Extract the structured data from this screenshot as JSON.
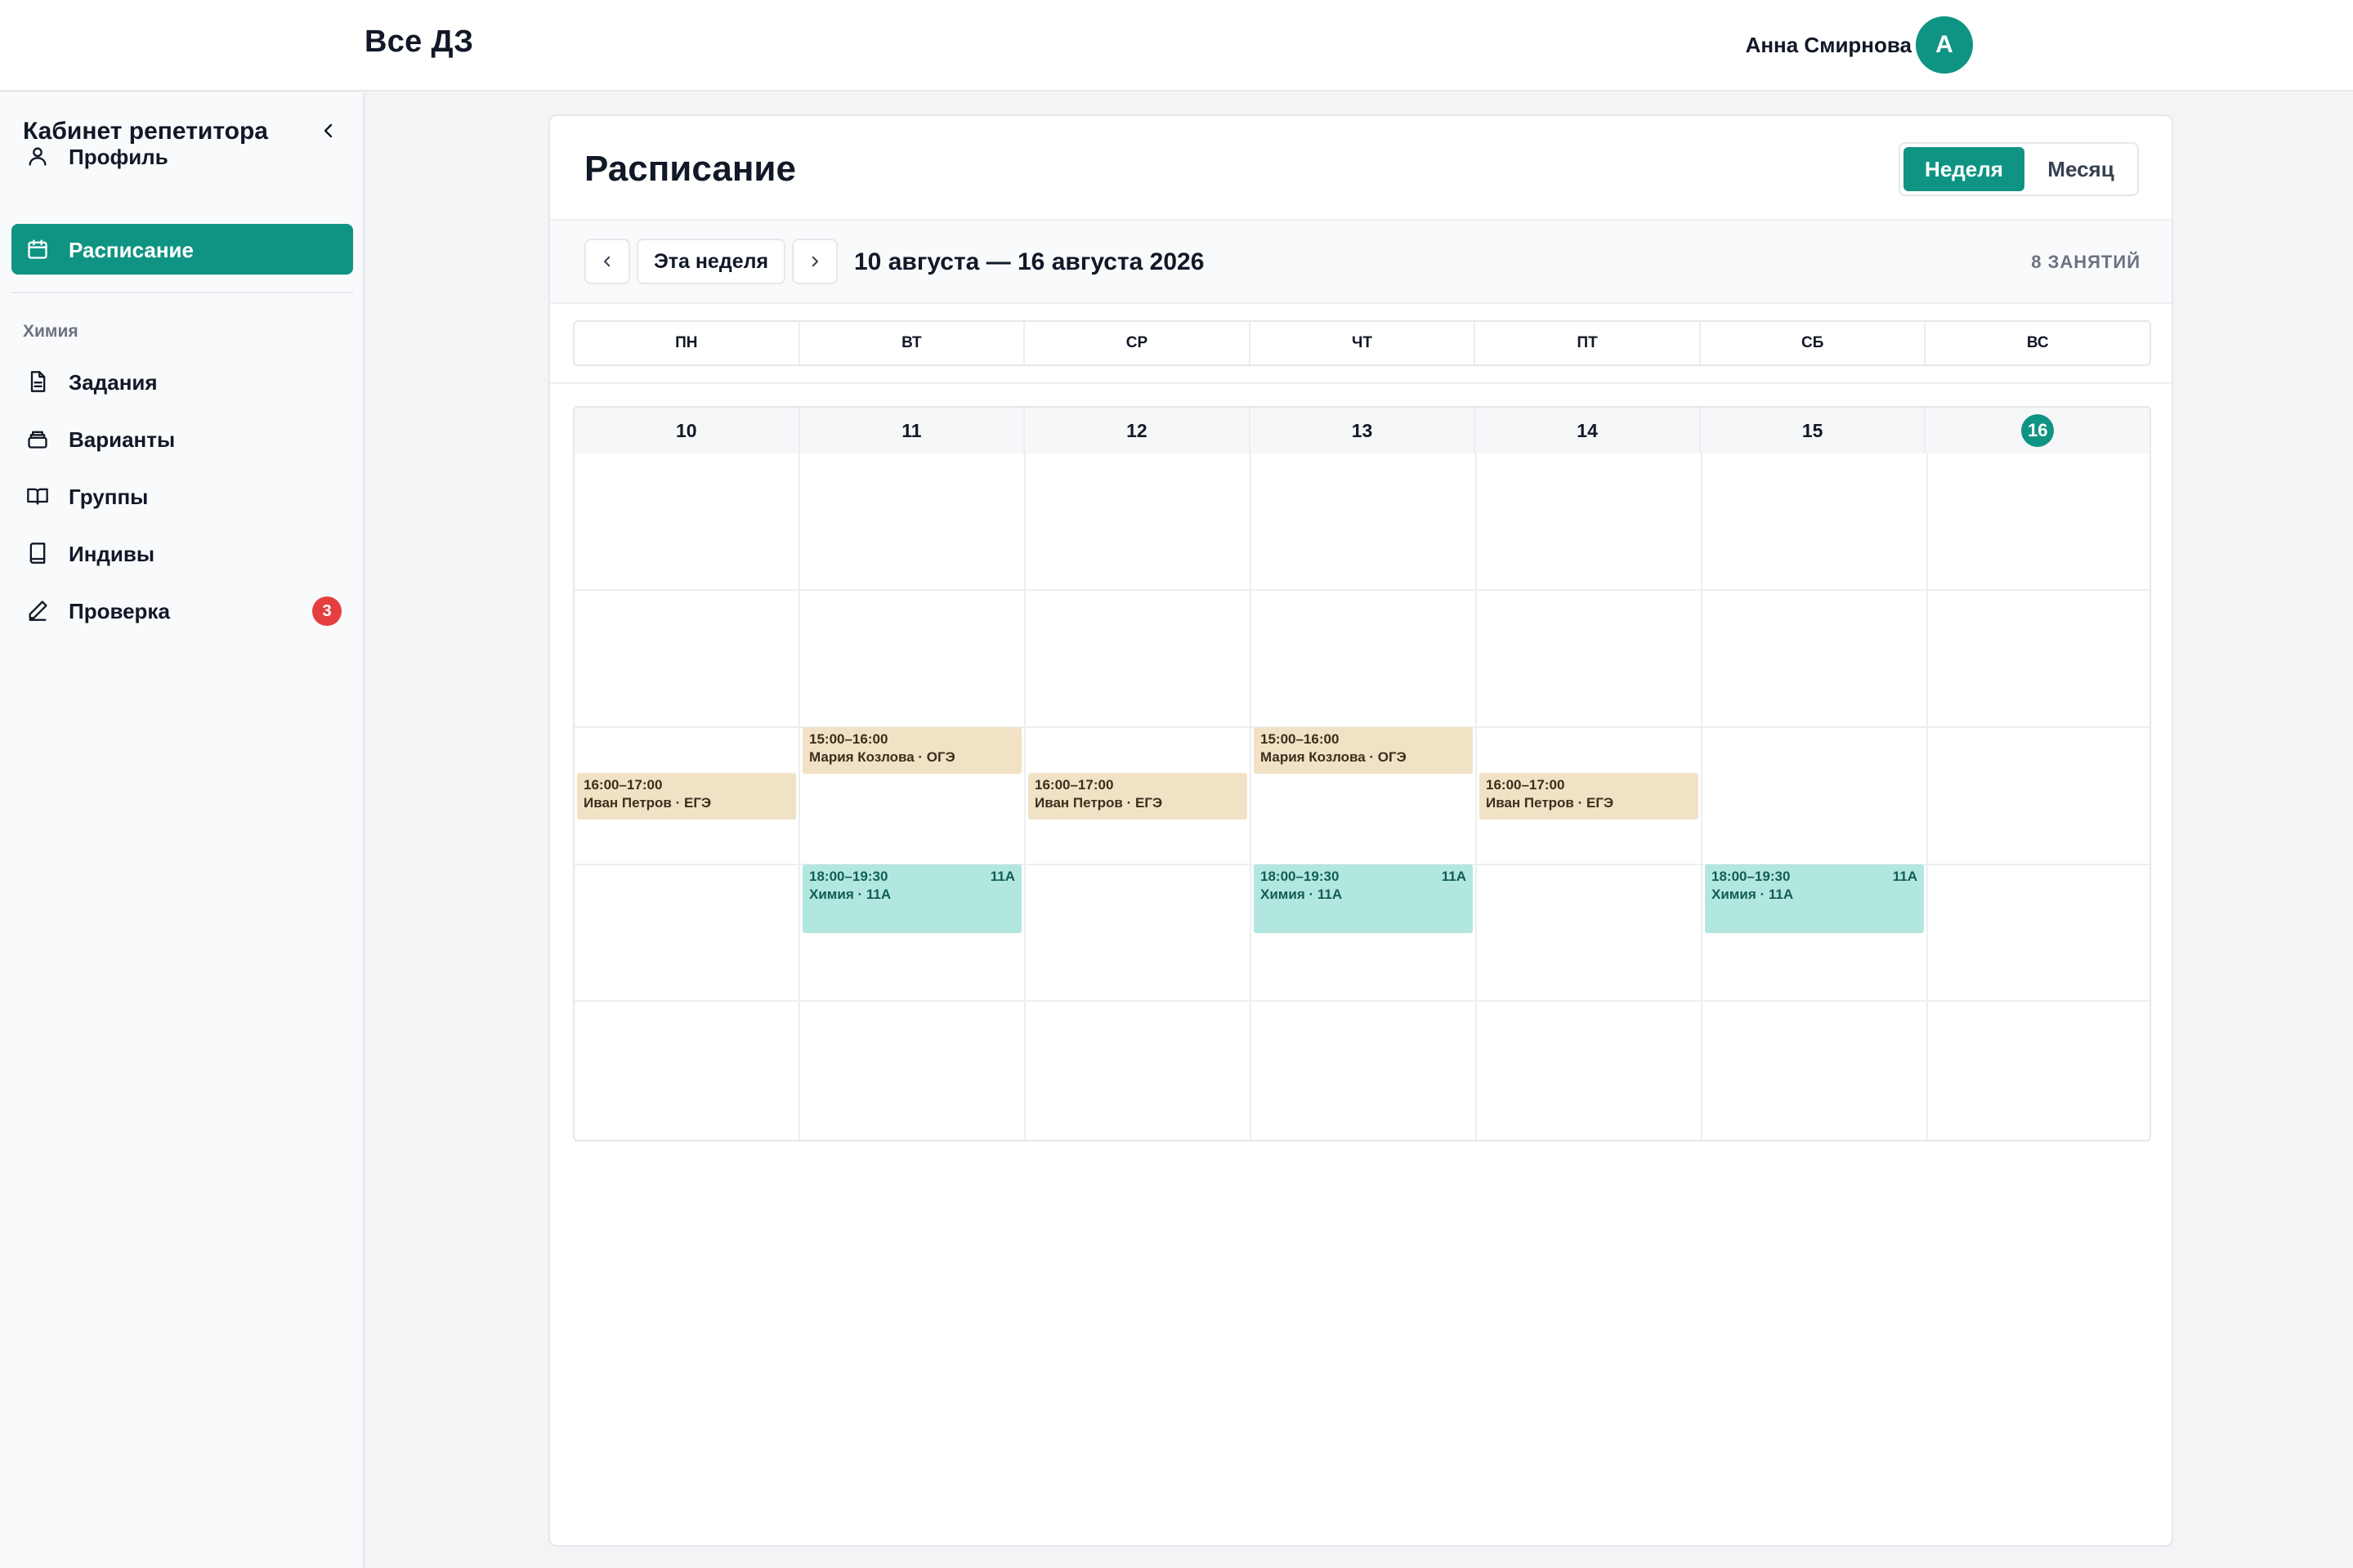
{
  "header": {
    "title": "Все ДЗ",
    "user_name": "Анна Смирнова",
    "avatar_letter": "А"
  },
  "sidebar": {
    "title": "Кабинет репетитора",
    "items": [
      {
        "label": "Профиль",
        "icon": "user-icon"
      },
      {
        "label": "Расписание",
        "icon": "calendar-icon",
        "active": true
      }
    ],
    "section_label": "Химия",
    "section_items": [
      {
        "label": "Задания",
        "icon": "document-icon"
      },
      {
        "label": "Варианты",
        "icon": "stack-icon"
      },
      {
        "label": "Группы",
        "icon": "book-open-icon"
      },
      {
        "label": "Индивы",
        "icon": "book-icon"
      },
      {
        "label": "Проверка",
        "icon": "pen-icon",
        "badge": "3"
      }
    ]
  },
  "main": {
    "title": "Расписание",
    "view_toggle": {
      "week": "Неделя",
      "month": "Месяц",
      "selected": "week"
    },
    "toolbar": {
      "today_label": "Эта неделя",
      "range": "10 августа — 16 августа 2026",
      "count": "8 ЗАНЯТИЙ"
    },
    "weekdays": [
      "ПН",
      "ВТ",
      "СР",
      "ЧТ",
      "ПТ",
      "СБ",
      "ВС"
    ],
    "days": [
      "10",
      "11",
      "12",
      "13",
      "14",
      "15",
      "16"
    ],
    "today": "16",
    "events": [
      {
        "time": "16:00–17:00",
        "title": "Иван Петров · ЕГЭ",
        "kind": "lesson"
      },
      {
        "time": "15:00–16:00",
        "title": "Мария Козлова · ОГЭ",
        "kind": "lesson"
      },
      {
        "time": "18:00–19:30",
        "title": "Химия · 11А",
        "tag": "11А",
        "kind": "group"
      },
      {
        "time": "16:00–17:00",
        "title": "Иван Петров · ЕГЭ",
        "kind": "lesson"
      },
      {
        "time": "15:00–16:00",
        "title": "Мария Козлова · ОГЭ",
        "kind": "lesson"
      },
      {
        "time": "18:00–19:30",
        "title": "Химия · 11А",
        "tag": "11А",
        "kind": "group"
      },
      {
        "time": "16:00–17:00",
        "title": "Иван Петров · ЕГЭ",
        "kind": "lesson"
      },
      {
        "time": "18:00–19:30",
        "title": "Химия · 11А",
        "tag": "11А",
        "kind": "group"
      }
    ]
  },
  "colors": {
    "accent": "#0f9483",
    "lesson_bg": "#f1e2c6",
    "group_bg": "#b2e7e0",
    "badge": "#e53e3e"
  }
}
